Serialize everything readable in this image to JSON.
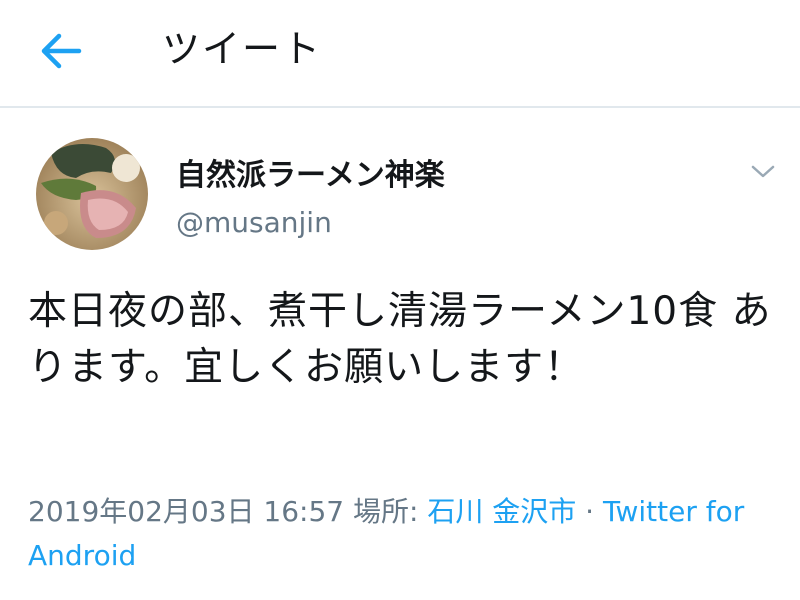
{
  "header": {
    "title": "ツイート",
    "back_icon": "arrow-left-icon",
    "accent_color": "#1da1f2"
  },
  "tweet": {
    "author": {
      "display_name": "自然派ラーメン神楽",
      "handle": "@musanjin",
      "avatar_icon": "ramen-bowl-avatar"
    },
    "menu_icon": "chevron-down-icon",
    "text": "本日夜の部、煮干し清湯ラーメン10食 あります。宜しくお願いします！",
    "meta": {
      "timestamp": "2019年02月03日 16:57",
      "location_label": "場所:",
      "location": "石川 金沢市",
      "separator": "·",
      "source": "Twitter for Android"
    }
  }
}
